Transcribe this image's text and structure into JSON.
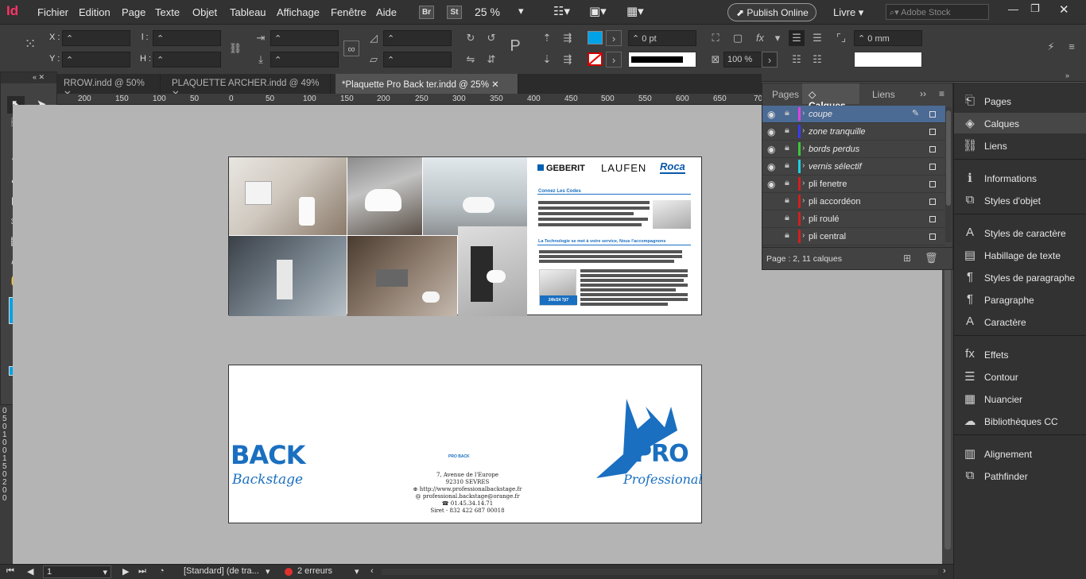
{
  "app": {
    "logo": "Id"
  },
  "menu": [
    "Fichier",
    "Edition",
    "Page",
    "Texte",
    "Objet",
    "Tableau",
    "Affichage",
    "Fenêtre",
    "Aide"
  ],
  "menubar_extras": {
    "br": "Br",
    "st": "St",
    "zoom": "25 %",
    "publish": "Publish Online",
    "workspace": "Livre",
    "search_placeholder": "Adobe Stock"
  },
  "control": {
    "x_label": "X :",
    "y_label": "Y :",
    "w_label": "l :",
    "h_label": "H :",
    "stroke_weight": "0 pt",
    "scale": "100 %",
    "offset": "0 mm",
    "fill_color": "#00a2e8"
  },
  "tabs": [
    "RROW.indd @ 50%",
    "PLAQUETTE ARCHER.indd @ 49%",
    "*Plaquette Pro Back ter.indd @ 25%"
  ],
  "ruler_h": [
    "200",
    "150",
    "100",
    "50",
    "0",
    "50",
    "100",
    "150",
    "200",
    "250",
    "300",
    "350",
    "400",
    "450",
    "500",
    "550",
    "600",
    "650",
    "70"
  ],
  "ruler_v": [
    "0",
    "5",
    "0",
    "1",
    "0",
    "0",
    "1",
    "5",
    "0",
    "2",
    "0",
    "0"
  ],
  "layers_panel": {
    "tabs": [
      "Pages",
      "Calques",
      "Liens"
    ],
    "layers": [
      {
        "name": "coupe",
        "color": "#e040e0",
        "selected": true,
        "visible": true
      },
      {
        "name": "zone tranquille",
        "color": "#3b3bff",
        "visible": true
      },
      {
        "name": "bords perdus",
        "color": "#3cc83c",
        "visible": true
      },
      {
        "name": "vernis sélectif",
        "color": "#20d0e0",
        "visible": true
      },
      {
        "name": "pli fenetre",
        "color": "#d02020",
        "visible": true
      },
      {
        "name": "pli accordéon",
        "color": "#d02020",
        "visible": false
      },
      {
        "name": "pli roulé",
        "color": "#d02020",
        "visible": false
      },
      {
        "name": "pli central",
        "color": "#d02020",
        "visible": false
      }
    ],
    "footer": "Page : 2, 11 calques"
  },
  "right_panel": [
    "Pages",
    "Calques",
    "Liens",
    "Informations",
    "Styles d'objet",
    "Styles de caractère",
    "Habillage de texte",
    "Styles de paragraphe",
    "Paragraphe",
    "Caractère",
    "Effets",
    "Contour",
    "Nuancier",
    "Bibliothèques CC",
    "Alignement",
    "Pathfinder"
  ],
  "document": {
    "brands": [
      "GEBERIT",
      "LAUFEN",
      "Roca"
    ],
    "headline1": "Connez Les Codes",
    "headline2": "La Technologie se met à votre service, Nous l'accompagnons",
    "badge": "24h/24 7j/7",
    "back_logo": {
      "line1": "BACK",
      "line2": "Backstage"
    },
    "pro_logo": {
      "line1": "PRO",
      "line2": "Professional"
    },
    "mini_logo": "PRO BACK",
    "address": [
      "7, Avenue de l'Europe",
      "92310 SEVRES",
      "http://www.professionalbackstage.fr",
      "professional.backstage@orange.fr",
      "01.45.34.14.71",
      "Siret - 832 422 687 00018"
    ]
  },
  "status": {
    "page": "1",
    "style": "[Standard] (de tra...",
    "errors": "2 erreurs"
  }
}
